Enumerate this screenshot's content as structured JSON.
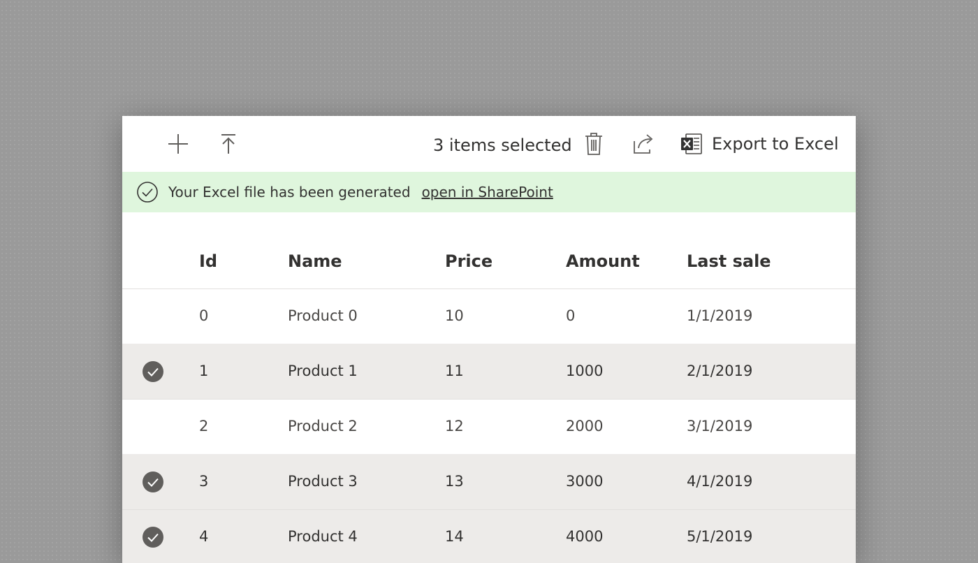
{
  "toolbar": {
    "add_icon": "plus-icon",
    "upload_icon": "upload-icon",
    "selection_text": "3 items selected",
    "delete_icon": "trash-icon",
    "share_icon": "share-icon",
    "export_icon": "excel-icon",
    "export_label": "Export to Excel"
  },
  "banner": {
    "icon": "checkmark-circle-icon",
    "message": "Your Excel file has been generated",
    "link_text": "open in SharePoint",
    "background": "#dff6dd"
  },
  "table": {
    "columns": [
      "Id",
      "Name",
      "Price",
      "Amount",
      "Last sale"
    ],
    "rows": [
      {
        "id": "0",
        "name": "Product 0",
        "price": "10",
        "amount": "0",
        "last_sale": "1/1/2019",
        "selected": false
      },
      {
        "id": "1",
        "name": "Product 1",
        "price": "11",
        "amount": "1000",
        "last_sale": "2/1/2019",
        "selected": true
      },
      {
        "id": "2",
        "name": "Product 2",
        "price": "12",
        "amount": "2000",
        "last_sale": "3/1/2019",
        "selected": false
      },
      {
        "id": "3",
        "name": "Product 3",
        "price": "13",
        "amount": "3000",
        "last_sale": "4/1/2019",
        "selected": true
      },
      {
        "id": "4",
        "name": "Product 4",
        "price": "14",
        "amount": "4000",
        "last_sale": "5/1/2019",
        "selected": true
      }
    ]
  },
  "colors": {
    "selected_row": "#edebe9",
    "check_badge": "#605e5c",
    "excel_green": "#217346"
  }
}
